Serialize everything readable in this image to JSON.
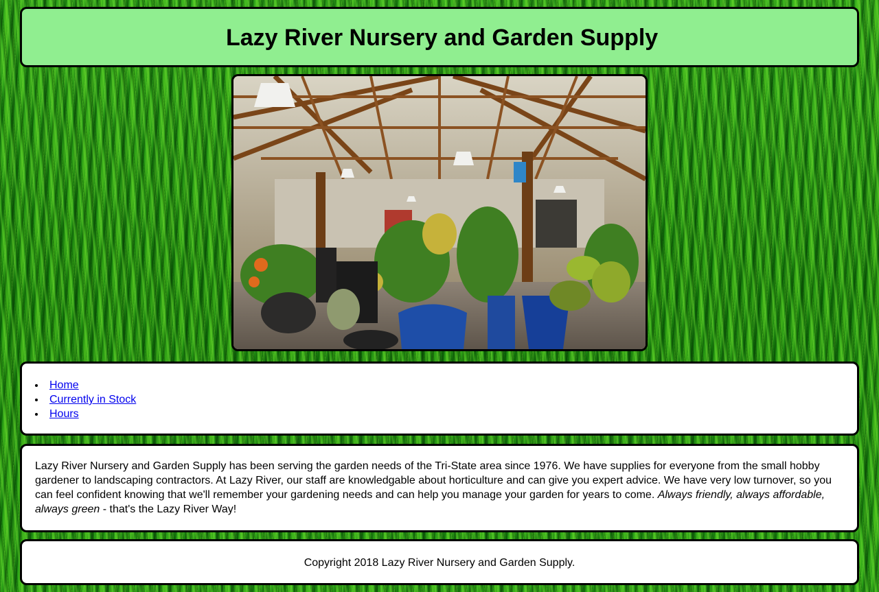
{
  "header": {
    "title": "Lazy River Nursery and Garden Supply",
    "background_color": "#90ee90"
  },
  "hero": {
    "image_description": "garden-center-interior-photo"
  },
  "nav": {
    "items": [
      {
        "label": "Home"
      },
      {
        "label": "Currently in Stock"
      },
      {
        "label": "Hours"
      }
    ],
    "link_color": "#0000ee"
  },
  "content": {
    "intro": "Lazy River Nursery and Garden Supply has been serving the garden needs of the Tri-State area since 1976. We have supplies for everyone from the small hobby gardener to landscaping contractors. At Lazy River, our staff are knowledgable about horticulture and can give you expert advice. We have very low turnover, so you can feel confident knowing that we'll remember your gardening needs and can help you manage your garden for years to come. ",
    "slogan": "Always friendly, always affordable, always green",
    "outro": " - that's the Lazy River Way!"
  },
  "footer": {
    "copyright": "Copyright 2018 Lazy River Nursery and Garden Supply."
  },
  "theme": {
    "page_background": "#1f8f12",
    "panel_border": "#000000",
    "panel_background": "#ffffff"
  }
}
